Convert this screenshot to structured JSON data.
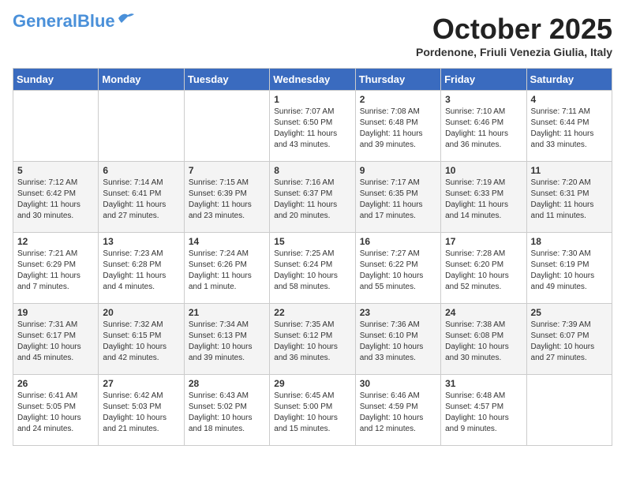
{
  "header": {
    "logo_general": "General",
    "logo_blue": "Blue",
    "month": "October 2025",
    "location": "Pordenone, Friuli Venezia Giulia, Italy"
  },
  "days_of_week": [
    "Sunday",
    "Monday",
    "Tuesday",
    "Wednesday",
    "Thursday",
    "Friday",
    "Saturday"
  ],
  "weeks": [
    [
      {
        "day": "",
        "info": ""
      },
      {
        "day": "",
        "info": ""
      },
      {
        "day": "",
        "info": ""
      },
      {
        "day": "1",
        "info": "Sunrise: 7:07 AM\nSunset: 6:50 PM\nDaylight: 11 hours and 43 minutes."
      },
      {
        "day": "2",
        "info": "Sunrise: 7:08 AM\nSunset: 6:48 PM\nDaylight: 11 hours and 39 minutes."
      },
      {
        "day": "3",
        "info": "Sunrise: 7:10 AM\nSunset: 6:46 PM\nDaylight: 11 hours and 36 minutes."
      },
      {
        "day": "4",
        "info": "Sunrise: 7:11 AM\nSunset: 6:44 PM\nDaylight: 11 hours and 33 minutes."
      }
    ],
    [
      {
        "day": "5",
        "info": "Sunrise: 7:12 AM\nSunset: 6:42 PM\nDaylight: 11 hours and 30 minutes."
      },
      {
        "day": "6",
        "info": "Sunrise: 7:14 AM\nSunset: 6:41 PM\nDaylight: 11 hours and 27 minutes."
      },
      {
        "day": "7",
        "info": "Sunrise: 7:15 AM\nSunset: 6:39 PM\nDaylight: 11 hours and 23 minutes."
      },
      {
        "day": "8",
        "info": "Sunrise: 7:16 AM\nSunset: 6:37 PM\nDaylight: 11 hours and 20 minutes."
      },
      {
        "day": "9",
        "info": "Sunrise: 7:17 AM\nSunset: 6:35 PM\nDaylight: 11 hours and 17 minutes."
      },
      {
        "day": "10",
        "info": "Sunrise: 7:19 AM\nSunset: 6:33 PM\nDaylight: 11 hours and 14 minutes."
      },
      {
        "day": "11",
        "info": "Sunrise: 7:20 AM\nSunset: 6:31 PM\nDaylight: 11 hours and 11 minutes."
      }
    ],
    [
      {
        "day": "12",
        "info": "Sunrise: 7:21 AM\nSunset: 6:29 PM\nDaylight: 11 hours and 7 minutes."
      },
      {
        "day": "13",
        "info": "Sunrise: 7:23 AM\nSunset: 6:28 PM\nDaylight: 11 hours and 4 minutes."
      },
      {
        "day": "14",
        "info": "Sunrise: 7:24 AM\nSunset: 6:26 PM\nDaylight: 11 hours and 1 minute."
      },
      {
        "day": "15",
        "info": "Sunrise: 7:25 AM\nSunset: 6:24 PM\nDaylight: 10 hours and 58 minutes."
      },
      {
        "day": "16",
        "info": "Sunrise: 7:27 AM\nSunset: 6:22 PM\nDaylight: 10 hours and 55 minutes."
      },
      {
        "day": "17",
        "info": "Sunrise: 7:28 AM\nSunset: 6:20 PM\nDaylight: 10 hours and 52 minutes."
      },
      {
        "day": "18",
        "info": "Sunrise: 7:30 AM\nSunset: 6:19 PM\nDaylight: 10 hours and 49 minutes."
      }
    ],
    [
      {
        "day": "19",
        "info": "Sunrise: 7:31 AM\nSunset: 6:17 PM\nDaylight: 10 hours and 45 minutes."
      },
      {
        "day": "20",
        "info": "Sunrise: 7:32 AM\nSunset: 6:15 PM\nDaylight: 10 hours and 42 minutes."
      },
      {
        "day": "21",
        "info": "Sunrise: 7:34 AM\nSunset: 6:13 PM\nDaylight: 10 hours and 39 minutes."
      },
      {
        "day": "22",
        "info": "Sunrise: 7:35 AM\nSunset: 6:12 PM\nDaylight: 10 hours and 36 minutes."
      },
      {
        "day": "23",
        "info": "Sunrise: 7:36 AM\nSunset: 6:10 PM\nDaylight: 10 hours and 33 minutes."
      },
      {
        "day": "24",
        "info": "Sunrise: 7:38 AM\nSunset: 6:08 PM\nDaylight: 10 hours and 30 minutes."
      },
      {
        "day": "25",
        "info": "Sunrise: 7:39 AM\nSunset: 6:07 PM\nDaylight: 10 hours and 27 minutes."
      }
    ],
    [
      {
        "day": "26",
        "info": "Sunrise: 6:41 AM\nSunset: 5:05 PM\nDaylight: 10 hours and 24 minutes."
      },
      {
        "day": "27",
        "info": "Sunrise: 6:42 AM\nSunset: 5:03 PM\nDaylight: 10 hours and 21 minutes."
      },
      {
        "day": "28",
        "info": "Sunrise: 6:43 AM\nSunset: 5:02 PM\nDaylight: 10 hours and 18 minutes."
      },
      {
        "day": "29",
        "info": "Sunrise: 6:45 AM\nSunset: 5:00 PM\nDaylight: 10 hours and 15 minutes."
      },
      {
        "day": "30",
        "info": "Sunrise: 6:46 AM\nSunset: 4:59 PM\nDaylight: 10 hours and 12 minutes."
      },
      {
        "day": "31",
        "info": "Sunrise: 6:48 AM\nSunset: 4:57 PM\nDaylight: 10 hours and 9 minutes."
      },
      {
        "day": "",
        "info": ""
      }
    ]
  ]
}
